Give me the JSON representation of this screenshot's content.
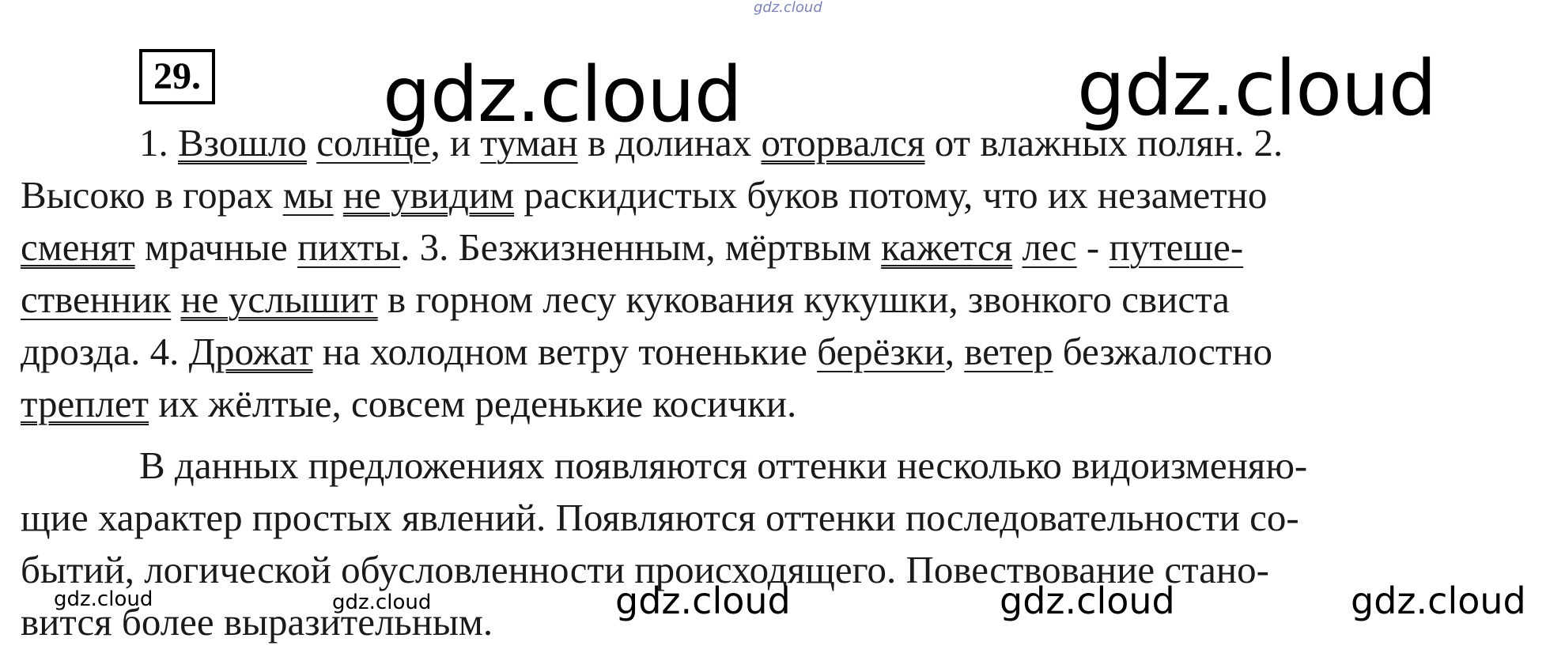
{
  "watermarks": {
    "top": "gdz.cloud",
    "big_left": "gdz.cloud",
    "big_right": "gdz.cloud",
    "bottom_1": "gdz.cloud",
    "bottom_2": "gdz.cloud",
    "bottom_3": "gdz.cloud",
    "bottom_small_1": "gdz.cloud",
    "bottom_small_2": "gdz.cloud"
  },
  "exercise_number": "29.",
  "p1": {
    "l1": [
      "1. ",
      "Взошло",
      " ",
      "солнце",
      ", и ",
      "туман",
      " в долинах ",
      "оторвался",
      " от влажных полян. 2."
    ],
    "l2": [
      "Высоко в горах ",
      "мы",
      " ",
      "не увидим",
      " раскидистых буков потому, что их незаметно"
    ],
    "l3": [
      "сменят",
      " мрачные ",
      "пихты",
      ". 3. Безжизненным, мёртвым ",
      "кажется",
      " ",
      "лес",
      " - ",
      "путеше-"
    ],
    "l4": [
      "ственник",
      " ",
      "не услышит",
      " в горном лесу кукования кукушки, звонкого свиста"
    ],
    "l5": [
      "дрозда. 4. ",
      "Дрожат",
      " на холодном ветру тоненькие ",
      "берёзки",
      ", ",
      "ветер",
      " безжалостно"
    ],
    "l6": [
      "треплет",
      " их жёлтые, совсем реденькие косички."
    ]
  },
  "p2": {
    "l1": "В данных предложениях появляются оттенки несколько видоизменяю-",
    "l2": "щие характер простых явлений. Появляются оттенки последовательности со-",
    "l3": "бытий, логической обусловленности происходящего. Повествование стано-",
    "l4": "вится более выразительным."
  }
}
